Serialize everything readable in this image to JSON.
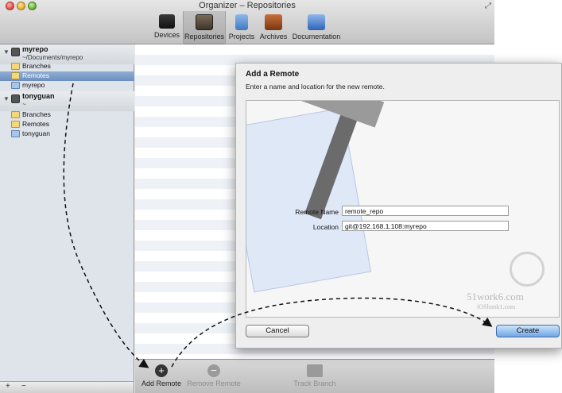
{
  "window": {
    "title": "Organizer – Repositories"
  },
  "toolbar": {
    "items": [
      {
        "label": "Devices",
        "icon": "devices-icon"
      },
      {
        "label": "Repositories",
        "icon": "repositories-icon",
        "selected": true
      },
      {
        "label": "Projects",
        "icon": "projects-icon"
      },
      {
        "label": "Archives",
        "icon": "archives-icon"
      },
      {
        "label": "Documentation",
        "icon": "documentation-icon"
      }
    ]
  },
  "sidebar": {
    "repos": [
      {
        "name": "myrepo",
        "path": "~/Documents/myrepo",
        "items": [
          {
            "label": "Branches",
            "icon": "folder-icon"
          },
          {
            "label": "Remotes",
            "icon": "folder-icon",
            "selected": true
          },
          {
            "label": "myrepo",
            "icon": "remote-icon"
          }
        ]
      },
      {
        "name": "tonyguan",
        "path": "~",
        "items": [
          {
            "label": "Branches",
            "icon": "folder-icon"
          },
          {
            "label": "Remotes",
            "icon": "folder-icon"
          },
          {
            "label": "tonyguan",
            "icon": "remote-icon"
          }
        ]
      }
    ],
    "bottom": {
      "add": "+",
      "remove": "−"
    }
  },
  "bottom_bar": {
    "add_remote": "Add Remote",
    "remove_remote": "Remove Remote",
    "track_branch": "Track Branch"
  },
  "sheet": {
    "title": "Add a Remote",
    "subtitle": "Enter a name and location for the new remote.",
    "remote_name_label": "Remote Name",
    "remote_name_value": "remote_repo",
    "location_label": "Location",
    "location_value": "git@192.168.1.108:myrepo",
    "cancel_label": "Cancel",
    "create_label": "Create"
  },
  "watermark": {
    "line1": "51work6.com",
    "line2": "iOSbook1.com"
  }
}
